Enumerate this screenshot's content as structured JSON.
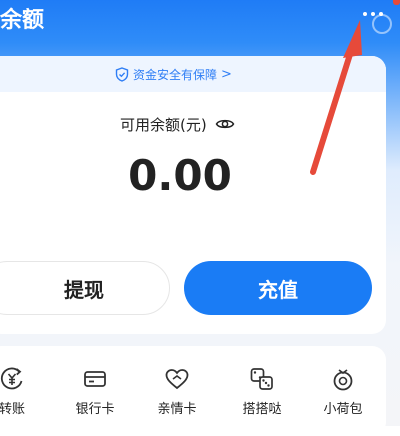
{
  "header": {
    "title": "余额",
    "more_icon": "more-dots-icon"
  },
  "colors": {
    "accent": "#1a7cf5",
    "header_blue": "#1f7cf6",
    "annotation_red": "#e64a3a"
  },
  "balance_card": {
    "safety_text": "资金安全有保障",
    "safety_icon": "shield-check-icon",
    "balance_label": "可用余额(元)",
    "visibility_icon": "eye-icon",
    "balance_value": "0.00"
  },
  "actions": {
    "withdraw_label": "提现",
    "topup_label": "充值"
  },
  "services": [
    {
      "label": "转账",
      "icon": "transfer-icon"
    },
    {
      "label": "银行卡",
      "icon": "bank-card-icon"
    },
    {
      "label": "亲情卡",
      "icon": "family-card-icon"
    },
    {
      "label": "搭搭哒",
      "icon": "dice-icon"
    },
    {
      "label": "小荷包",
      "icon": "purse-icon"
    }
  ]
}
